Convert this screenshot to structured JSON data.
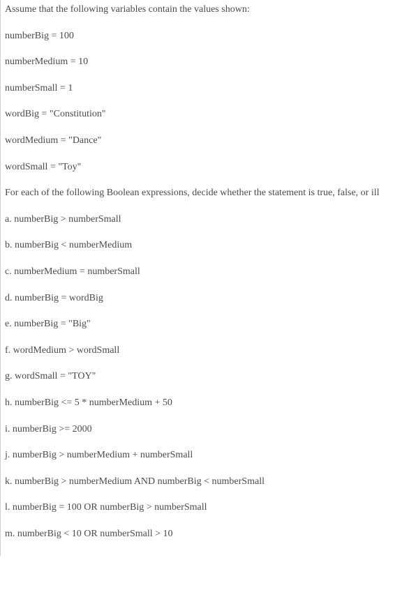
{
  "intro": "Assume that the following variables contain the values shown:",
  "vars": {
    "v1": "numberBig = 100",
    "v2": "numberMedium = 10",
    "v3": "numberSmall = 1",
    "v4": "wordBig = \"Constitution\"",
    "v5": "wordMedium = \"Dance\"",
    "v6": "wordSmall = \"Toy\""
  },
  "prompt": "For each of the following Boolean expressions, decide whether the statement is true, false, or ill",
  "items": {
    "a": "a. numberBig > numberSmall",
    "b": "b. numberBig < numberMedium",
    "c": "c. numberMedium = numberSmall",
    "d": "d. numberBig = wordBig",
    "e": "e. numberBig = \"Big\"",
    "f": "f. wordMedium > wordSmall",
    "g": "g. wordSmall = \"TOY\"",
    "h": "h. numberBig <= 5 * numberMedium + 50",
    "i": "i. numberBig >= 2000",
    "j": "j. numberBig > numberMedium + numberSmall",
    "k": "k. numberBig > numberMedium AND numberBig < numberSmall",
    "l": "l. numberBig = 100 OR numberBig > numberSmall",
    "m": "m. numberBig < 10 OR numberSmall > 10"
  }
}
